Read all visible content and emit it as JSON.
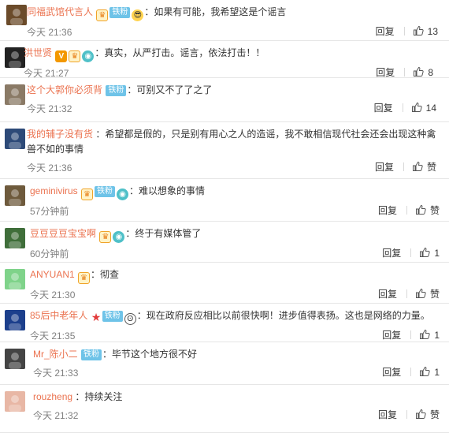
{
  "labels": {
    "reply": "回复"
  },
  "comments": [
    {
      "username": "同福武馆代言人",
      "icons": [
        "crown",
        "badge",
        "face"
      ],
      "text": "：如果有可能，我希望这是个谣言",
      "time": "今天 21:36",
      "likes": "13"
    },
    {
      "username": "洪世贤",
      "icons": [
        "v",
        "crown",
        "eye"
      ],
      "text": "：真实，从严打击。谣言，依法打击！！",
      "time": "今天 21:27",
      "likes": "8"
    },
    {
      "username": "这个大郭你必须背",
      "icons": [
        "badge"
      ],
      "text": "：可别又不了了之了",
      "time": "今天 21:32",
      "likes": "14"
    },
    {
      "username": "我的辅子没有货",
      "icons": [],
      "text": "：希望都是假的，只是别有用心之人的造谣，我不敢相信现代社会还会出现这种禽兽不如的事情",
      "time": "今天 21:36",
      "likes": "赞"
    },
    {
      "username": "geminivirus",
      "icons": [
        "crown",
        "badge",
        "eye"
      ],
      "text": "：难以想象的事情",
      "time": "57分钟前",
      "likes": "赞"
    },
    {
      "username": "豆豆豆豆宝宝啊",
      "icons": [
        "crown",
        "eye"
      ],
      "text": "：终于有媒体管了",
      "time": "60分钟前",
      "likes": "1"
    },
    {
      "username": "ANYUAN1",
      "icons": [
        "crown"
      ],
      "text": "：彻查",
      "time": "今天 21:30",
      "likes": "赞"
    },
    {
      "username": "85后中老年人",
      "icons": [
        "star",
        "badge",
        "panda"
      ],
      "text": "：现在政府反应相比以前很快啊！进步值得表扬。这也是网络的力量。",
      "time": "今天 21:35",
      "likes": "1"
    },
    {
      "username": "Mr_陈小二",
      "icons": [
        "badge"
      ],
      "text": "：毕节这个地方很不好",
      "time": "今天 21:33",
      "likes": "1"
    },
    {
      "username": "rouzheng",
      "icons": [],
      "text": "：持续关注",
      "time": "今天 21:32",
      "likes": "赞"
    }
  ],
  "badge_text": "铁粉",
  "colors": {
    "username": "#eb7350",
    "badge": "#6ec3e8",
    "time": "#808080"
  }
}
